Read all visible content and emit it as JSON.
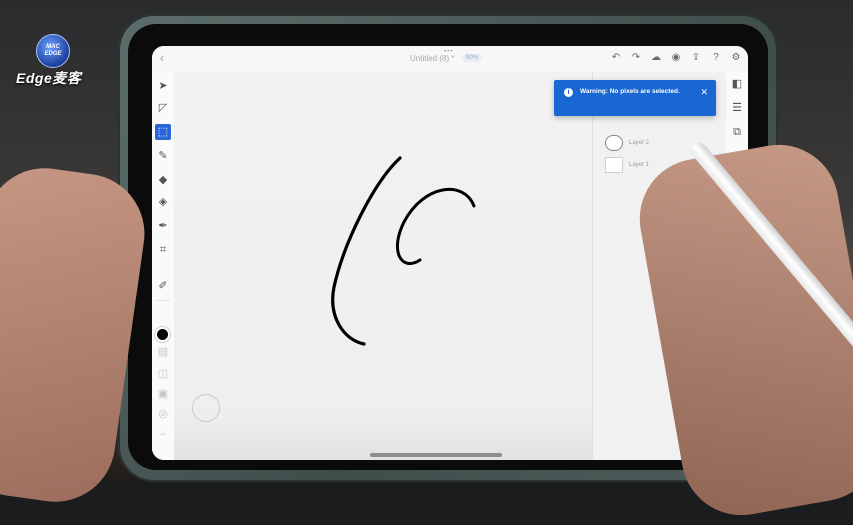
{
  "watermark": {
    "logo_text": "MAC EDGE",
    "brand": "Edge麦客"
  },
  "app": {
    "title": "Untitled (8) *",
    "zoom": "90%",
    "back_glyph": "‹",
    "grip": "•••"
  },
  "top_icons": [
    "undo-icon",
    "redo-icon",
    "cloud-icon",
    "account-icon",
    "share-icon",
    "help-icon",
    "settings-icon"
  ],
  "left_tools": [
    "select-tool",
    "lasso-tool",
    "selection-rect-tool",
    "brush-tool",
    "eraser-tool",
    "fill-tool",
    "pen-tool",
    "crop-tool",
    "eyedropper-tool",
    "color-swatch",
    "layer-tool",
    "adjust-tool",
    "mask-tool",
    "smudge-tool",
    "more-tool"
  ],
  "warning": {
    "icon": "i",
    "text": "Warning: No pixels are selected.",
    "close": "✕"
  },
  "layers": [
    {
      "name": "Layer 2",
      "selected": true
    },
    {
      "name": "Layer 1",
      "selected": false
    }
  ],
  "colors": {
    "accent": "#2a66d8",
    "toast": "#1967d2",
    "ink": "#000000"
  }
}
